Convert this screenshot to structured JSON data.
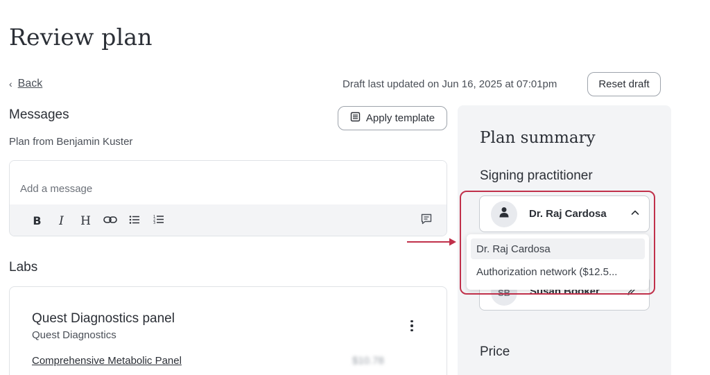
{
  "page": {
    "title": "Review plan"
  },
  "nav": {
    "back_label": "Back"
  },
  "draft": {
    "status": "Draft last updated on Jun 16, 2025 at 07:01pm",
    "reset_label": "Reset draft"
  },
  "messages": {
    "title": "Messages",
    "apply_template_label": "Apply template",
    "plan_from": "Plan from Benjamin Kuster",
    "placeholder": "Add a message",
    "toolbar": {
      "bold": "B",
      "italic": "I",
      "heading": "H"
    }
  },
  "labs": {
    "title": "Labs",
    "card": {
      "name": "Quest Diagnostics panel",
      "vendor": "Quest Diagnostics",
      "test": "Comprehensive Metabolic Panel",
      "price": "$10.78"
    }
  },
  "summary": {
    "title": "Plan summary",
    "signing_label": "Signing practitioner",
    "selected_practitioner": "Dr. Raj Cardosa",
    "dropdown_options": [
      "Dr. Raj Cardosa",
      "Authorization network ($12.5..."
    ],
    "second_practitioner": {
      "initials": "SB",
      "name": "Susan Booker"
    },
    "price_label": "Price"
  },
  "colors": {
    "highlight": "#c0304a",
    "panel_bg": "#f3f4f6",
    "text": "#2b2f36"
  }
}
